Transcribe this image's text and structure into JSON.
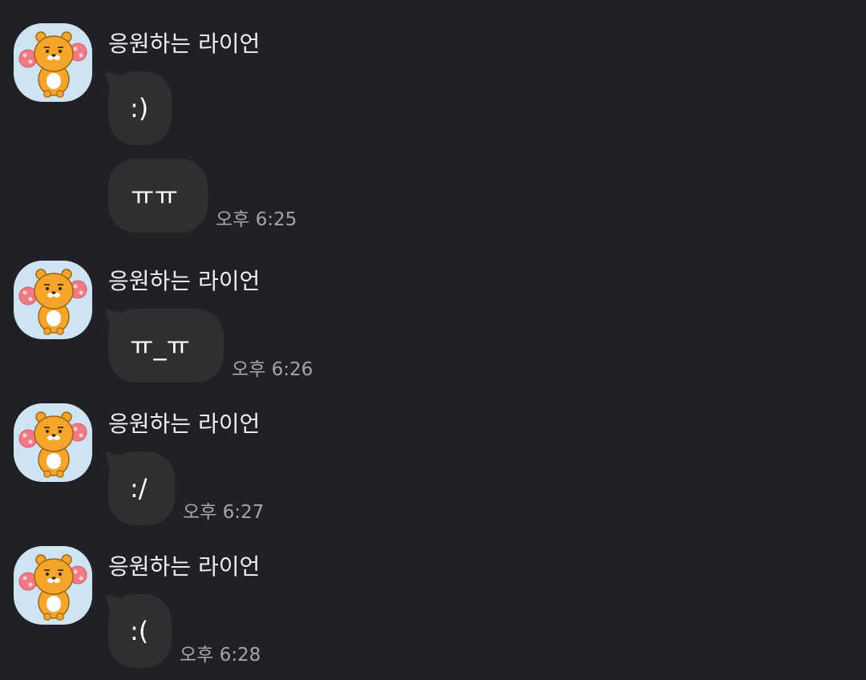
{
  "chat": {
    "groups": [
      {
        "sender": "응원하는 라이언",
        "avatar_icon": "ryan-cheering-icon",
        "messages": [
          {
            "text": ":)",
            "time": ""
          },
          {
            "text": "ㅠㅠ",
            "time": "오후 6:25"
          }
        ]
      },
      {
        "sender": "응원하는 라이언",
        "avatar_icon": "ryan-cheering-icon",
        "messages": [
          {
            "text": "ㅠ_ㅠ",
            "time": "오후 6:26"
          }
        ]
      },
      {
        "sender": "응원하는 라이언",
        "avatar_icon": "ryan-cheering-icon",
        "messages": [
          {
            "text": ":/",
            "time": "오후 6:27"
          }
        ]
      },
      {
        "sender": "응원하는 라이언",
        "avatar_icon": "ryan-cheering-icon",
        "messages": [
          {
            "text": ":(",
            "time": "오후 6:28"
          }
        ]
      }
    ]
  },
  "colors": {
    "background": "#202126",
    "bubble": "#2f2f31",
    "avatar_bg": "#cfe4f3",
    "text": "#ffffff",
    "timestamp": "#a6a6a8"
  }
}
